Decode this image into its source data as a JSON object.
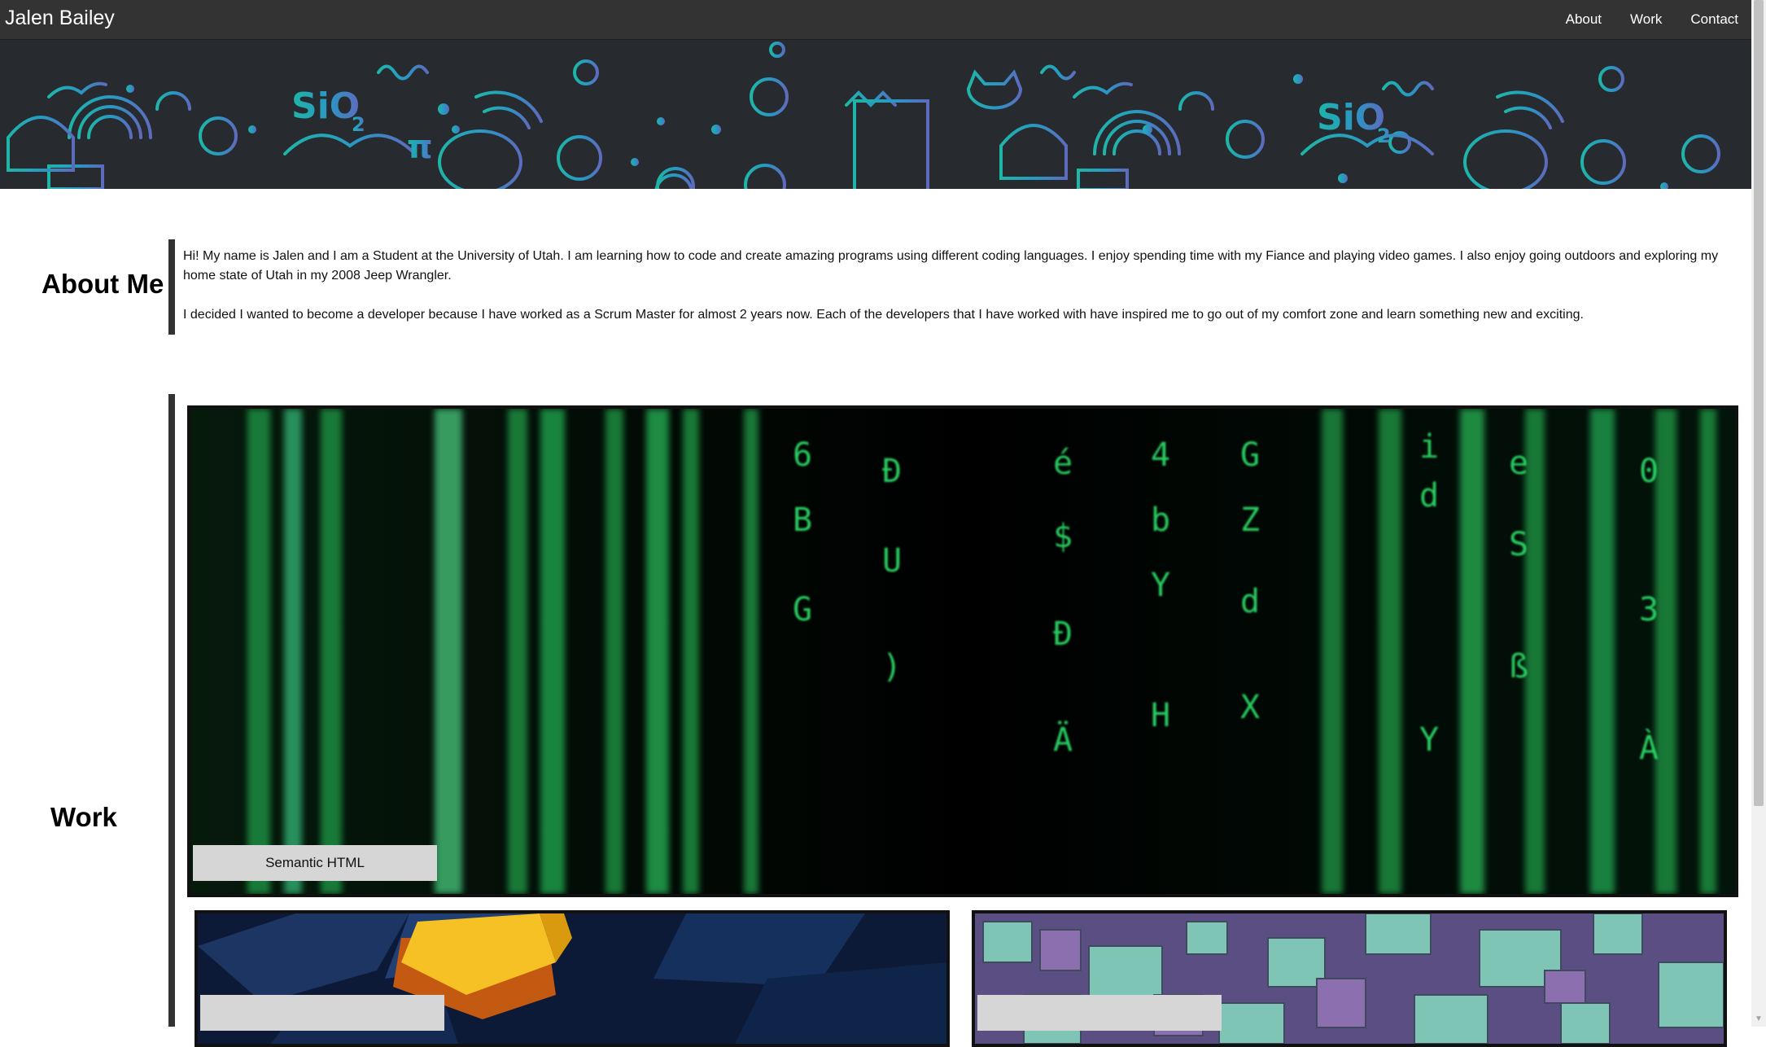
{
  "header": {
    "brand": "Jalen Bailey",
    "nav": [
      {
        "label": "About"
      },
      {
        "label": "Work"
      },
      {
        "label": "Contact"
      }
    ]
  },
  "hero": {
    "formula_1": "SiO",
    "formula_1_sub": "2",
    "formula_2": "SiO",
    "formula_2_sub": "2",
    "pi": "π"
  },
  "about": {
    "title": "About Me",
    "paragraphs": [
      "Hi! My name is Jalen and I am a Student at the University of Utah. I am learning how to code and create amazing programs using different coding languages. I enjoy spending time with my Fiance and playing video games. I also enjoy going outdoors and exploring my home state of Utah in my 2008 Jeep Wrangler.",
      "I decided I wanted to become a developer because I have worked as a Scrum Master for almost 2 years now. Each of the developers that I have worked with have inspired me to go out of my comfort zone and learn something new and exciting."
    ]
  },
  "work": {
    "title": "Work",
    "projects": [
      {
        "label": "Semantic HTML"
      },
      {
        "label": ""
      },
      {
        "label": ""
      }
    ]
  },
  "colors": {
    "nav_bg": "#333333",
    "hero_bg": "#272a2e",
    "matrix_green": "#1fc456",
    "doodle_teal": "#1fb5a8",
    "doodle_blue": "#3b86c9"
  }
}
